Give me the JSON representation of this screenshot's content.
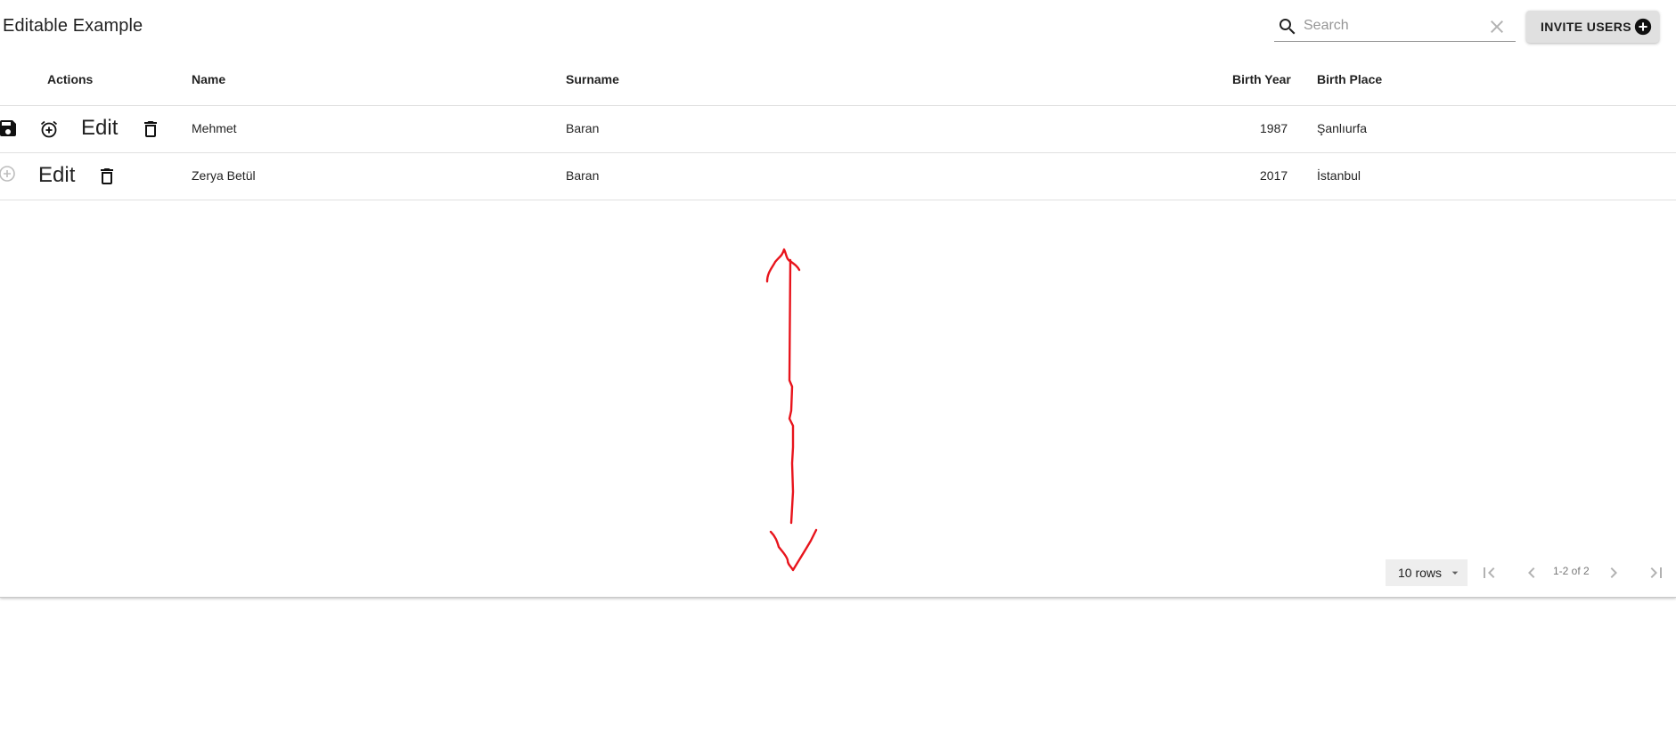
{
  "toolbar": {
    "title": "Editable Example",
    "search_placeholder": "Search",
    "search_value": "",
    "invite_label": "INVITE USERS"
  },
  "table": {
    "headers": {
      "actions": "Actions",
      "name": "Name",
      "surname": "Surname",
      "birth_year": "Birth Year",
      "birth_place": "Birth Place"
    },
    "rows": [
      {
        "edit_label": "Edit",
        "name": "Mehmet",
        "surname": "Baran",
        "birth_year": "1987",
        "birth_place": "Şanlıurfa",
        "action_icons": [
          "save-icon",
          "alarm-add-icon",
          "edit",
          "delete-icon"
        ]
      },
      {
        "edit_label": "Edit",
        "name": "Zerya Betül",
        "surname": "Baran",
        "birth_year": "2017",
        "birth_place": "İstanbul",
        "action_icons": [
          "add-circle-icon",
          "edit",
          "delete-icon"
        ]
      }
    ]
  },
  "pagination": {
    "rows_per_page": "10 rows",
    "range_label": "1-2 of 2"
  },
  "colors": {
    "annotation": "#e8141c",
    "header_border": "#e0e0e0",
    "button_bg": "#e0e0e0"
  }
}
